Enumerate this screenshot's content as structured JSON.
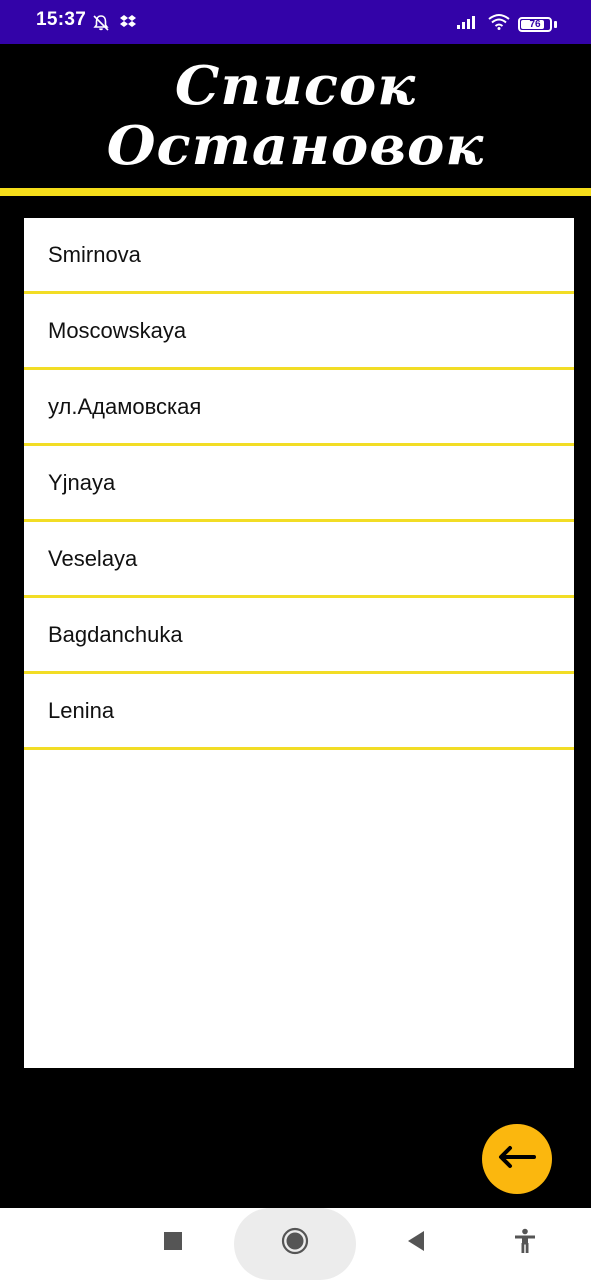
{
  "status_bar": {
    "time": "15:37",
    "battery_level": "76",
    "icons": [
      "bell-off-icon",
      "dropbox-icon",
      "signal-icon",
      "wifi-icon",
      "battery-icon"
    ]
  },
  "header": {
    "title_line1": "Список",
    "title_line2": "Остановок"
  },
  "stops": [
    {
      "label": "Smirnova"
    },
    {
      "label": "Moscowskaya"
    },
    {
      "label": "ул.Адамовская"
    },
    {
      "label": "Yjnaya"
    },
    {
      "label": "Veselaya"
    },
    {
      "label": "Bagdanchuka"
    },
    {
      "label": "Lenina"
    }
  ],
  "fab": {
    "icon": "arrow-left-icon"
  },
  "nav_bar": {
    "icons": [
      "recents-square-icon",
      "home-circle-icon",
      "back-triangle-icon",
      "accessibility-icon"
    ]
  },
  "colors": {
    "status_bar": "#3303a8",
    "background": "#000000",
    "accent_yellow": "#f5dd1a",
    "fab": "#fbb70e"
  }
}
